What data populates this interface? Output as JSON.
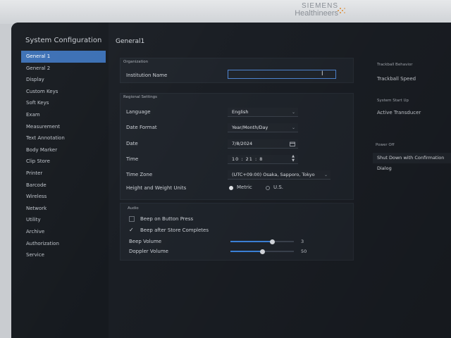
{
  "brand": {
    "line1": "SIEMENS",
    "line2": "Healthineers"
  },
  "sidebar": {
    "title": "System Configuration",
    "items": [
      {
        "label": "General 1"
      },
      {
        "label": "General 2"
      },
      {
        "label": "Display"
      },
      {
        "label": "Custom Keys"
      },
      {
        "label": "Soft Keys"
      },
      {
        "label": "Exam"
      },
      {
        "label": "Measurement"
      },
      {
        "label": "Text Annotation"
      },
      {
        "label": "Body Marker"
      },
      {
        "label": "Clip Store"
      },
      {
        "label": "Printer"
      },
      {
        "label": "Barcode"
      },
      {
        "label": "Wireless"
      },
      {
        "label": "Network"
      },
      {
        "label": "Utility"
      },
      {
        "label": "Archive"
      },
      {
        "label": "Authorization"
      },
      {
        "label": "Service"
      }
    ],
    "active_index": 0
  },
  "main": {
    "title": "General1",
    "organization": {
      "label": "Organization",
      "institution_name_label": "Institution Name",
      "institution_name_value": ""
    },
    "regional": {
      "label": "Regional Settings",
      "language_label": "Language",
      "language_value": "English",
      "date_format_label": "Date Format",
      "date_format_value": "Year/Month/Day",
      "date_label": "Date",
      "date_value": "7/8/2024",
      "time_label": "Time",
      "time_hh": "10",
      "time_mm": "21",
      "time_ss": "8",
      "time_sep": ":",
      "timezone_label": "Time Zone",
      "timezone_value": "(UTC+09:00) Osaka, Sapporo, Tokyo",
      "units_label": "Height and Weight Units",
      "unit_metric": "Metric",
      "unit_us": "U.S.",
      "unit_selected": "Metric"
    },
    "audio": {
      "label": "Audio",
      "beep_button_label": "Beep on Button Press",
      "beep_button_checked": false,
      "beep_store_label": "Beep after Store Completes",
      "beep_store_checked": true,
      "beep_volume_label": "Beep Volume",
      "beep_volume_value": "3",
      "beep_volume_fraction": 0.66,
      "doppler_volume_label": "Doppler Volume",
      "doppler_volume_value": "50",
      "doppler_volume_fraction": 0.5
    },
    "trackball": {
      "label": "Trackball Behavior",
      "speed_label": "Trackball Speed"
    },
    "startup": {
      "label": "System Start Up",
      "transducer_label": "Active Transducer"
    },
    "power": {
      "label": "Power Off",
      "value": "Shut Down with Confirmation Dialog"
    }
  },
  "colors": {
    "accent": "#3b6fb4",
    "slider": "#3e86e0",
    "background": "#1a1e24"
  }
}
